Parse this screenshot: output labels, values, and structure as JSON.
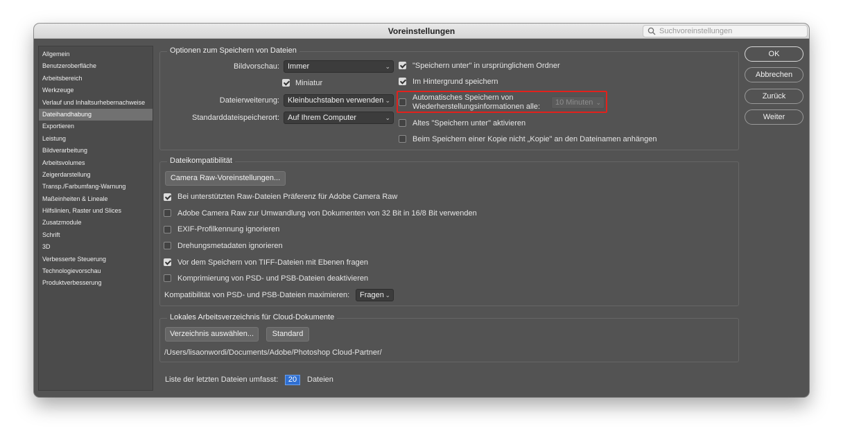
{
  "window": {
    "title": "Voreinstellungen",
    "search_placeholder": "Suchvoreinstellungen"
  },
  "sidebar": {
    "items": [
      {
        "label": "Allgemein"
      },
      {
        "label": "Benutzeroberfläche"
      },
      {
        "label": "Arbeitsbereich"
      },
      {
        "label": "Werkzeuge"
      },
      {
        "label": "Verlauf und Inhaltsurhebernachweise"
      },
      {
        "label": "Dateihandhabung",
        "selected": true
      },
      {
        "label": "Exportieren"
      },
      {
        "label": "Leistung"
      },
      {
        "label": "Bildverarbeitung"
      },
      {
        "label": "Arbeitsvolumes"
      },
      {
        "label": "Zeigerdarstellung"
      },
      {
        "label": "Transp./Farbumfang-Warnung"
      },
      {
        "label": "Maßeinheiten & Lineale"
      },
      {
        "label": "Hilfslinien, Raster und Slices"
      },
      {
        "label": "Zusatzmodule"
      },
      {
        "label": "Schrift"
      },
      {
        "label": "3D"
      },
      {
        "label": "Verbesserte Steuerung"
      },
      {
        "label": "Technologievorschau"
      },
      {
        "label": "Produktverbesserung"
      }
    ]
  },
  "save_options": {
    "title": "Optionen zum Speichern von Dateien",
    "preview_label": "Bildvorschau:",
    "preview_value": "Immer",
    "thumbnail_label": "Miniatur",
    "thumbnail_checked": true,
    "extension_label": "Dateierweiterung:",
    "extension_value": "Kleinbuchstaben verwenden",
    "default_location_label": "Standarddateispeicherort:",
    "default_location_value": "Auf Ihrem Computer",
    "save_as_original_label": "\"Speichern unter\" in ursprünglichem Ordner",
    "save_as_original_checked": true,
    "background_save_label": "Im Hintergrund speichern",
    "background_save_checked": true,
    "autosave_label_line1": "Automatisches Speichern von",
    "autosave_label_line2": "Wiederherstellungsinformationen alle:",
    "autosave_checked": false,
    "autosave_interval": "10 Minuten",
    "legacy_save_as_label": "Altes \"Speichern unter\" aktivieren",
    "legacy_save_as_checked": false,
    "no_copy_suffix_label": "Beim Speichern einer Kopie nicht „Kopie\" an den Dateinamen anhängen",
    "no_copy_suffix_checked": false
  },
  "compatibility": {
    "title": "Dateikompatibilität",
    "camera_raw_button": "Camera Raw-Voreinstellungen...",
    "options": [
      {
        "label": "Bei unterstützten Raw-Dateien Präferenz für Adobe Camera Raw",
        "checked": true
      },
      {
        "label": "Adobe Camera Raw zur Umwandlung von Dokumenten von 32 Bit in 16/8 Bit verwenden",
        "checked": false
      },
      {
        "label": "EXIF-Profilkennung ignorieren",
        "checked": false
      },
      {
        "label": "Drehungsmetadaten ignorieren",
        "checked": false
      },
      {
        "label": "Vor dem Speichern von TIFF-Dateien mit Ebenen fragen",
        "checked": true
      },
      {
        "label": "Komprimierung von PSD- und PSB-Dateien deaktivieren",
        "checked": false
      }
    ],
    "maximize_label": "Kompatibilität von PSD- und PSB-Dateien maximieren:",
    "maximize_value": "Fragen"
  },
  "cloud": {
    "title": "Lokales Arbeitsverzeichnis für Cloud-Dokumente",
    "choose_button": "Verzeichnis auswählen...",
    "default_button": "Standard",
    "path": "/Users/lisaonwordi/Documents/Adobe/Photoshop Cloud-Partner/"
  },
  "recent_files": {
    "label": "Liste der letzten Dateien umfasst:",
    "value": "20",
    "suffix": "Dateien"
  },
  "buttons": {
    "ok": "OK",
    "cancel": "Abbrechen",
    "back": "Zurück",
    "next": "Weiter"
  },
  "colors": {
    "window_bg": "#535353",
    "highlight": "#e3211c",
    "field_focus": "#2f6fd1"
  }
}
